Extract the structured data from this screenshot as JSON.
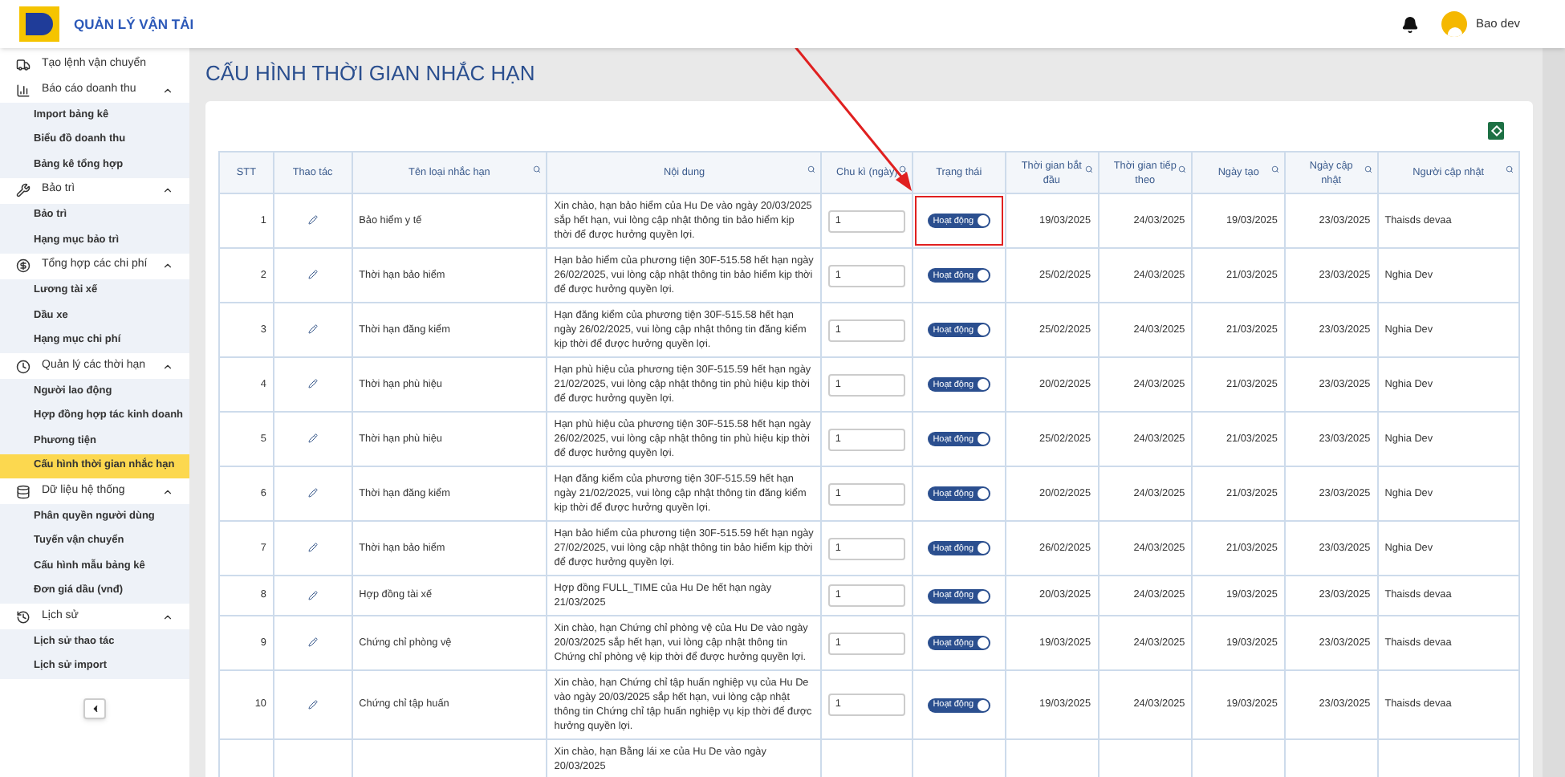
{
  "header": {
    "app_title": "QUẢN LÝ VẬN TẢI",
    "user_name": "Bao dev"
  },
  "sidebar": {
    "items": [
      {
        "label": "Tạo lệnh vận chuyển"
      },
      {
        "label": "Báo cáo doanh thu",
        "expanded": true,
        "children": [
          {
            "label": "Import bảng kê",
            "selected": false
          },
          {
            "label": "Biểu đồ doanh thu",
            "selected": false
          },
          {
            "label": "Bảng kê tổng hợp",
            "selected": false
          }
        ]
      },
      {
        "label": "Bảo trì",
        "expanded": true,
        "children": [
          {
            "label": "Bảo trì",
            "selected": false
          },
          {
            "label": "Hạng mục bảo trì",
            "selected": false
          }
        ]
      },
      {
        "label": "Tổng hợp các chi phí",
        "expanded": true,
        "children": [
          {
            "label": "Lương tài xế",
            "selected": false
          },
          {
            "label": "Dầu xe",
            "selected": false
          },
          {
            "label": "Hạng mục chi phí",
            "selected": false
          }
        ]
      },
      {
        "label": "Quản lý các thời hạn",
        "expanded": true,
        "children": [
          {
            "label": "Người lao động",
            "selected": false
          },
          {
            "label": "Hợp đồng hợp tác kinh doanh",
            "selected": false
          },
          {
            "label": "Phương tiện",
            "selected": false
          },
          {
            "label": "Cấu hình thời gian nhắc hạn",
            "selected": true
          }
        ]
      },
      {
        "label": "Dữ liệu hệ thống",
        "expanded": true,
        "children": [
          {
            "label": "Phân quyền người dùng",
            "selected": false
          },
          {
            "label": "Tuyến vận chuyển",
            "selected": false
          },
          {
            "label": "Cấu hình mẫu bảng kê",
            "selected": false
          },
          {
            "label": "Đơn giá dầu (vnđ)",
            "selected": false
          }
        ]
      },
      {
        "label": "Lịch sử",
        "expanded": true,
        "children": [
          {
            "label": "Lịch sử thao tác",
            "selected": false
          },
          {
            "label": "Lịch sử import",
            "selected": false
          }
        ]
      }
    ]
  },
  "page_title": "CẤU HÌNH THỜI GIAN NHẮC HẠN",
  "table": {
    "columns": [
      {
        "label": "STT",
        "searchable": false
      },
      {
        "label": "Thao tác",
        "searchable": false
      },
      {
        "label": "Tên loại nhắc hạn",
        "searchable": true
      },
      {
        "label": "Nội dung",
        "searchable": true
      },
      {
        "label": "Chu kì (ngày)",
        "searchable": true
      },
      {
        "label": "Trạng thái",
        "searchable": false
      },
      {
        "label": "Thời gian bắt đầu",
        "searchable": true
      },
      {
        "label": "Thời gian tiếp theo",
        "searchable": true
      },
      {
        "label": "Ngày tạo",
        "searchable": true
      },
      {
        "label": "Ngày cập nhật",
        "searchable": true
      },
      {
        "label": "Người cập nhật",
        "searchable": true
      }
    ],
    "rows": [
      {
        "stt": "1",
        "name": "Bảo hiểm y tế",
        "content": "Xin chào, hạn bảo hiểm của Hu De vào ngày 20/03/2025 sắp hết hạn, vui lòng cập nhật thông tin bảo hiểm kịp thời để được hưởng quyền lợi.",
        "cycle": "1",
        "status_label": "Hoạt động",
        "on": true,
        "highlighted": true,
        "start": "19/03/2025",
        "next": "24/03/2025",
        "created": "19/03/2025",
        "updated": "23/03/2025",
        "updated_by": "Thaisds devaa"
      },
      {
        "stt": "2",
        "name": "Thời hạn bảo hiểm",
        "content": "Hạn bảo hiểm của phương tiện 30F-515.58 hết hạn ngày 26/02/2025, vui lòng cập nhật thông tin bảo hiểm kịp thời để được hưởng quyền lợi.",
        "cycle": "1",
        "status_label": "Hoạt động",
        "on": true,
        "highlighted": false,
        "start": "25/02/2025",
        "next": "24/03/2025",
        "created": "21/03/2025",
        "updated": "23/03/2025",
        "updated_by": "Nghia Dev"
      },
      {
        "stt": "3",
        "name": "Thời hạn đăng kiểm",
        "content": "Hạn đăng kiểm của phương tiện 30F-515.58 hết hạn ngày 26/02/2025, vui lòng cập nhật thông tin đăng kiểm kịp thời để được hưởng quyền lợi.",
        "cycle": "1",
        "status_label": "Hoạt động",
        "on": true,
        "highlighted": false,
        "start": "25/02/2025",
        "next": "24/03/2025",
        "created": "21/03/2025",
        "updated": "23/03/2025",
        "updated_by": "Nghia Dev"
      },
      {
        "stt": "4",
        "name": "Thời hạn phù hiệu",
        "content": "Hạn phù hiệu của phương tiện 30F-515.59 hết hạn ngày 21/02/2025, vui lòng cập nhật thông tin phù hiệu kịp thời để được hưởng quyền lợi.",
        "cycle": "1",
        "status_label": "Hoạt động",
        "on": true,
        "highlighted": false,
        "start": "20/02/2025",
        "next": "24/03/2025",
        "created": "21/03/2025",
        "updated": "23/03/2025",
        "updated_by": "Nghia Dev"
      },
      {
        "stt": "5",
        "name": "Thời hạn phù hiệu",
        "content": "Hạn phù hiệu của phương tiện 30F-515.58 hết hạn ngày 26/02/2025, vui lòng cập nhật thông tin phù hiệu kịp thời để được hưởng quyền lợi.",
        "cycle": "1",
        "status_label": "Hoạt động",
        "on": true,
        "highlighted": false,
        "start": "25/02/2025",
        "next": "24/03/2025",
        "created": "21/03/2025",
        "updated": "23/03/2025",
        "updated_by": "Nghia Dev"
      },
      {
        "stt": "6",
        "name": "Thời hạn đăng kiểm",
        "content": "Hạn đăng kiểm của phương tiện 30F-515.59 hết hạn ngày 21/02/2025, vui lòng cập nhật thông tin đăng kiểm kịp thời để được hưởng quyền lợi.",
        "cycle": "1",
        "status_label": "Hoạt động",
        "on": true,
        "highlighted": false,
        "start": "20/02/2025",
        "next": "24/03/2025",
        "created": "21/03/2025",
        "updated": "23/03/2025",
        "updated_by": "Nghia Dev"
      },
      {
        "stt": "7",
        "name": "Thời hạn bảo hiểm",
        "content": "Hạn bảo hiểm của phương tiện 30F-515.59 hết hạn ngày 27/02/2025, vui lòng cập nhật thông tin bảo hiểm kịp thời để được hưởng quyền lợi.",
        "cycle": "1",
        "status_label": "Hoạt động",
        "on": true,
        "highlighted": false,
        "start": "26/02/2025",
        "next": "24/03/2025",
        "created": "21/03/2025",
        "updated": "23/03/2025",
        "updated_by": "Nghia Dev"
      },
      {
        "stt": "8",
        "name": "Hợp đồng tài xế",
        "content": "Hợp đồng FULL_TIME của Hu De hết hạn ngày 21/03/2025",
        "cycle": "1",
        "status_label": "Hoạt động",
        "on": true,
        "highlighted": false,
        "start": "20/03/2025",
        "next": "24/03/2025",
        "created": "19/03/2025",
        "updated": "23/03/2025",
        "updated_by": "Thaisds devaa"
      },
      {
        "stt": "9",
        "name": "Chứng chỉ phòng vệ",
        "content": "Xin chào, hạn Chứng chỉ phòng vệ của Hu De vào ngày 20/03/2025 sắp hết hạn, vui lòng cập nhật thông tin Chứng chỉ phòng vệ kịp thời để được hưởng quyền lợi.",
        "cycle": "1",
        "status_label": "Hoạt động",
        "on": true,
        "highlighted": false,
        "start": "19/03/2025",
        "next": "24/03/2025",
        "created": "19/03/2025",
        "updated": "23/03/2025",
        "updated_by": "Thaisds devaa"
      },
      {
        "stt": "10",
        "name": "Chứng chỉ tập huấn",
        "content": "Xin chào, hạn Chứng chỉ tập huấn nghiệp vụ của Hu De vào ngày 20/03/2025 sắp hết hạn, vui lòng cập nhật thông tin Chứng chỉ tập huấn nghiệp vụ kịp thời để được hưởng quyền lợi.",
        "cycle": "1",
        "status_label": "Hoạt động",
        "on": true,
        "highlighted": false,
        "start": "19/03/2025",
        "next": "24/03/2025",
        "created": "19/03/2025",
        "updated": "23/03/2025",
        "updated_by": "Thaisds devaa"
      },
      {
        "content": "Xin chào, hạn Bằng lái xe của Hu De vào ngày 20/03/2025",
        "highlighted": false
      }
    ]
  }
}
